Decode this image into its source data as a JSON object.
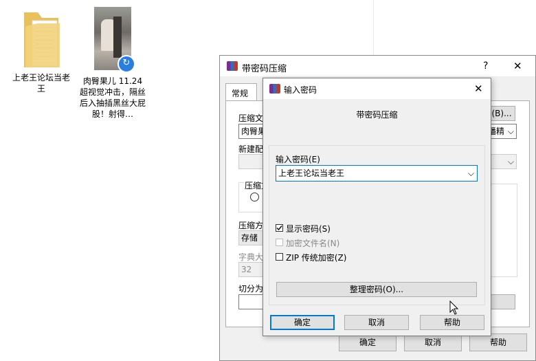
{
  "desktop": {
    "folder_label": "上老王论坛当老王",
    "video_label": "肉臀果儿 11.24超视觉冲击，隔丝后入抽插黑丝大屁股！射得…"
  },
  "winrar": {
    "title": "带密码压缩",
    "help_glyph": "?",
    "close_glyph": "✕",
    "tab_general": "常规",
    "label_archive_name": "压缩文",
    "archive_name_value": "肉臀果",
    "browse_button": "(B)...",
    "format_value": "播精",
    "label_new_profile": "新建配",
    "label_archive_format": "压缩文",
    "label_compression_method": "压缩方",
    "method_value": "存储",
    "label_dictionary": "字典大",
    "dictionary_value": "32",
    "label_split": "切分为",
    "ok": "确定",
    "cancel": "取消",
    "help": "帮助"
  },
  "password_dialog": {
    "title": "输入密码",
    "close_glyph": "✕",
    "heading": "带密码压缩",
    "label_password": "输入密码(E)",
    "password_value": "上老王论坛当老王",
    "show_password": "显示密码(S)",
    "show_password_checked": true,
    "encrypt_filenames": "加密文件名(N)",
    "encrypt_filenames_checked": false,
    "zip_legacy": "ZIP 传统加密(Z)",
    "zip_legacy_checked": false,
    "organize_button": "整理密码(O)...",
    "ok": "确定",
    "cancel": "取消",
    "help": "帮助"
  }
}
